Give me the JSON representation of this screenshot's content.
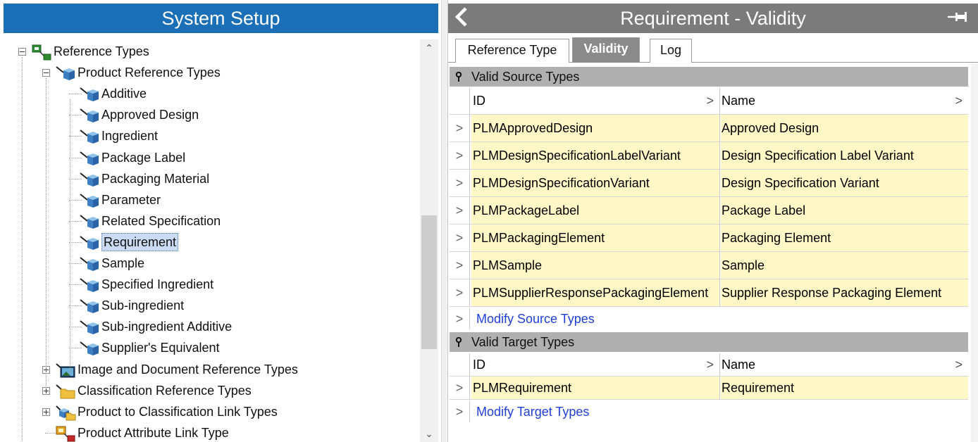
{
  "left": {
    "title": "System Setup",
    "tree": [
      {
        "label": "Reference Types",
        "level": 0,
        "expander": "minus",
        "icon": "reference-types-icon"
      },
      {
        "label": "Product Reference Types",
        "level": 1,
        "expander": "minus",
        "icon": "product-reference-icon"
      },
      {
        "label": "Additive",
        "level": 2,
        "icon": "reference-cube-icon"
      },
      {
        "label": "Approved Design",
        "level": 2,
        "icon": "reference-cube-icon"
      },
      {
        "label": "Ingredient",
        "level": 2,
        "icon": "reference-cube-icon"
      },
      {
        "label": "Package Label",
        "level": 2,
        "icon": "reference-cube-icon"
      },
      {
        "label": "Packaging Material",
        "level": 2,
        "icon": "reference-cube-icon"
      },
      {
        "label": "Parameter",
        "level": 2,
        "icon": "reference-cube-icon"
      },
      {
        "label": "Related Specification",
        "level": 2,
        "icon": "reference-cube-icon"
      },
      {
        "label": "Requirement",
        "level": 2,
        "icon": "reference-cube-icon",
        "selected": true
      },
      {
        "label": "Sample",
        "level": 2,
        "icon": "reference-cube-icon"
      },
      {
        "label": "Specified Ingredient",
        "level": 2,
        "icon": "reference-cube-icon"
      },
      {
        "label": "Sub-ingredient",
        "level": 2,
        "icon": "reference-cube-icon"
      },
      {
        "label": "Sub-ingredient Additive",
        "level": 2,
        "icon": "reference-cube-icon"
      },
      {
        "label": "Supplier's Equivalent",
        "level": 2,
        "icon": "reference-cube-icon"
      },
      {
        "label": "Image and Document Reference Types",
        "level": 1,
        "expander": "plus",
        "icon": "image-reference-icon"
      },
      {
        "label": "Classification Reference Types",
        "level": 1,
        "expander": "plus",
        "icon": "folder-reference-icon"
      },
      {
        "label": "Product to Classification Link Types",
        "level": 1,
        "expander": "plus",
        "icon": "link-types-icon"
      },
      {
        "label": "Product Attribute Link Type",
        "level": 1,
        "icon": "attribute-link-icon"
      }
    ]
  },
  "right": {
    "title": "Requirement - Validity",
    "tabs": [
      "Reference Type",
      "Validity",
      "Log"
    ],
    "active_tab": "Validity",
    "source": {
      "header": "Valid Source Types",
      "col_id": "ID",
      "col_name": "Name",
      "rows": [
        {
          "id": "PLMApprovedDesign",
          "name": "Approved Design"
        },
        {
          "id": "PLMDesignSpecificationLabelVariant",
          "name": "Design Specification Label Variant"
        },
        {
          "id": "PLMDesignSpecificationVariant",
          "name": "Design Specification Variant"
        },
        {
          "id": "PLMPackageLabel",
          "name": "Package Label"
        },
        {
          "id": "PLMPackagingElement",
          "name": "Packaging Element"
        },
        {
          "id": "PLMSample",
          "name": "Sample"
        },
        {
          "id": "PLMSupplierResponsePackagingElement",
          "name": "Supplier Response Packaging Element"
        }
      ],
      "modify_link": "Modify Source Types"
    },
    "target": {
      "header": "Valid Target Types",
      "col_id": "ID",
      "col_name": "Name",
      "rows": [
        {
          "id": "PLMRequirement",
          "name": "Requirement"
        }
      ],
      "modify_link": "Modify Target Types"
    }
  }
}
